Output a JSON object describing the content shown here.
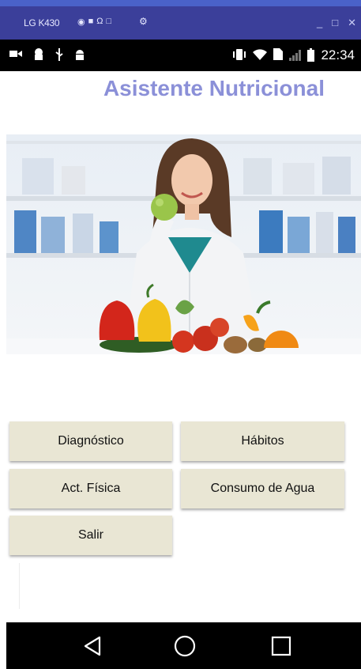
{
  "window": {
    "title": "LG K430",
    "controls": [
      "_",
      "□",
      "✕"
    ]
  },
  "status_bar": {
    "time": "22:34",
    "left_icons": [
      "video-camera-icon",
      "android-debug-icon",
      "usb-icon",
      "android-icon"
    ],
    "right_icons": [
      "vibrate-icon",
      "wifi-icon",
      "signal-icon",
      "battery-icon"
    ]
  },
  "app": {
    "title": "Asistente Nutricional",
    "title_color": "#8b90d8",
    "hero_image": "nutritionist-with-vegetables-image",
    "buttons": {
      "diagnostico": "Diagnóstico",
      "habitos": "Hábitos",
      "actividad": "Act. Física",
      "agua": "Consumo de Agua",
      "salir": "Salir"
    },
    "button_color": "#e9e6d4"
  },
  "nav_bar": {
    "icons": [
      "back-icon",
      "home-icon",
      "recents-icon"
    ]
  }
}
